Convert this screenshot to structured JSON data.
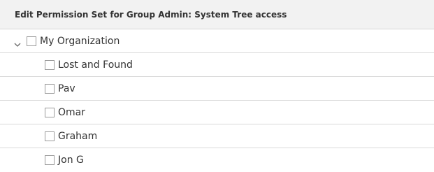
{
  "header": {
    "title": "Edit Permission Set for Group Admin: System Tree access"
  },
  "tree": {
    "root": {
      "label": "My Organization",
      "expanded": true,
      "checked": false
    },
    "children": [
      {
        "label": "Lost and Found",
        "checked": false
      },
      {
        "label": "Pav",
        "checked": false
      },
      {
        "label": "Omar",
        "checked": false
      },
      {
        "label": "Graham",
        "checked": false
      },
      {
        "label": "Jon G",
        "checked": false
      }
    ]
  },
  "colors": {
    "header_bg": "#f2f2f2",
    "row_border": "#d9d9d9",
    "checkbox_border": "#9a9a9a",
    "text": "#333333"
  },
  "icons": {
    "expand": "chevron-down-icon"
  }
}
